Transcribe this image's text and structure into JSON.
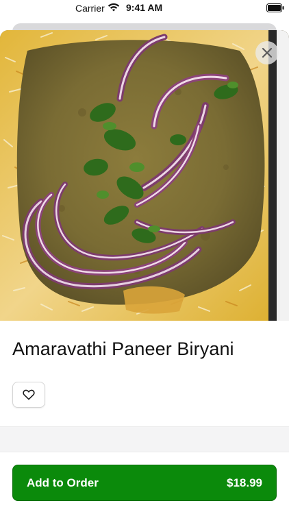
{
  "status_bar": {
    "carrier": "Carrier",
    "time": "9:41 AM",
    "wifi_icon": "wifi-icon",
    "battery_icon": "battery-icon"
  },
  "item": {
    "title": "Amaravathi Paneer Biryani",
    "image_subject": "paneer biryani with onion slices and cilantro"
  },
  "actions": {
    "close_icon": "close-icon",
    "favorite_icon": "heart-icon",
    "add_to_order_label": "Add to Order",
    "price": "$18.99"
  },
  "colors": {
    "accent": "#0b8a0b"
  }
}
